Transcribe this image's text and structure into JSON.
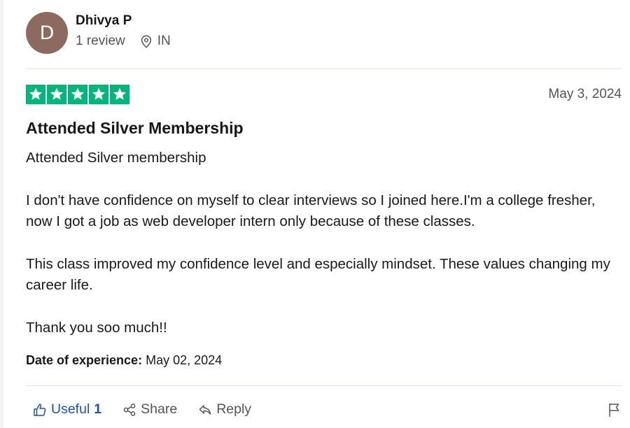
{
  "reviewer": {
    "initial": "D",
    "name": "Dhivya P",
    "review_count": "1 review",
    "country": "IN",
    "avatar_color": "#8c6a5f"
  },
  "review": {
    "rating": 5,
    "rating_max": 5,
    "star_color": "#00b67a",
    "date": "May 3, 2024",
    "title": "Attended Silver Membership",
    "paragraphs": [
      "Attended Silver membership",
      "I don't have confidence on myself to clear interviews so I joined here.I'm a college fresher, now I got a job as web developer intern only because of these classes.",
      "This class improved my confidence level and especially mindset. These values changing my career life.",
      "Thank you soo much!!"
    ],
    "experience_label": "Date of experience:",
    "experience_date": "May 02, 2024"
  },
  "actions": {
    "useful_label": "Useful",
    "useful_count": "1",
    "share_label": "Share",
    "reply_label": "Reply"
  },
  "icons": {
    "location": "map-pin-icon",
    "useful": "thumbs-up-icon",
    "share": "share-icon",
    "reply": "reply-icon",
    "report": "flag-icon"
  }
}
